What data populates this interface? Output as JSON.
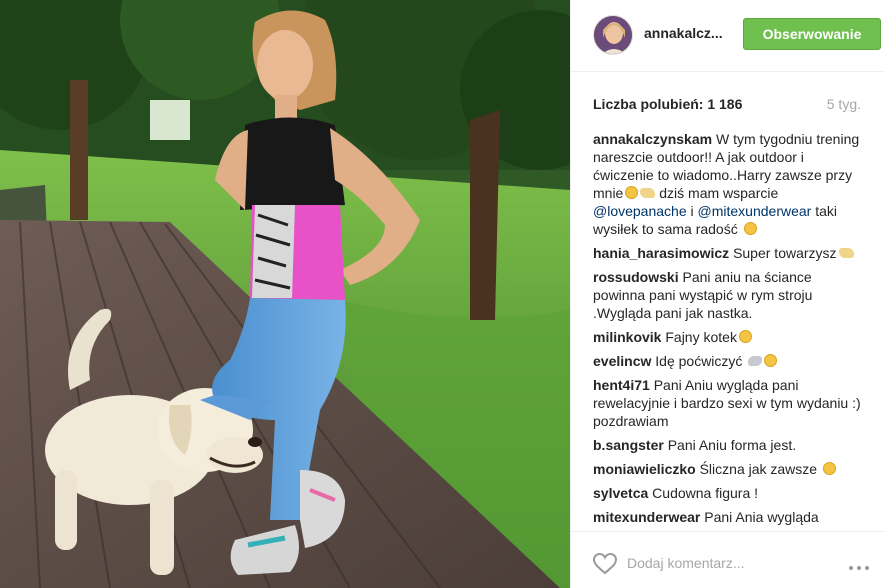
{
  "post": {
    "username": "annakalcz...",
    "follow_label": "Obserwowanie",
    "likes_text": "Liczba polubień: 1 186",
    "age_text": "5 tyg."
  },
  "comments": [
    {
      "user": "annakalczynskam",
      "parts": [
        {
          "t": "W tym tygodniu trening nareszcie outdoor!! A jak outdoor i ćwiczenie to wiadomo..Harry zawsze przy mnie"
        },
        {
          "emoji": "face"
        },
        {
          "emoji": "dog"
        },
        {
          "t": " dziś mam wsparcie "
        },
        {
          "mention": "@lovepanache"
        },
        {
          "t": " i "
        },
        {
          "mention": "@mitexunderwear"
        },
        {
          "t": " taki wysiłek to sama radość "
        },
        {
          "emoji": "face"
        }
      ]
    },
    {
      "user": "hania_harasimowicz",
      "parts": [
        {
          "t": "Super towarzysz"
        },
        {
          "emoji": "dog"
        }
      ]
    },
    {
      "user": "rossudowski",
      "parts": [
        {
          "t": "Pani aniu na ściance powinna pani wystąpić w rym stroju .Wygląda pani jak nastka."
        }
      ]
    },
    {
      "user": "milinkovik",
      "parts": [
        {
          "t": "Fajny kotek"
        },
        {
          "emoji": "face"
        }
      ]
    },
    {
      "user": "evelincw",
      "parts": [
        {
          "t": "Idę poćwiczyć "
        },
        {
          "emoji": "arm"
        },
        {
          "emoji": "face"
        }
      ]
    },
    {
      "user": "hent4i71",
      "parts": [
        {
          "t": "Pani Aniu wygląda pani rewelacyjnie i bardzo sexi w tym wydaniu :) pozdrawiam"
        }
      ]
    },
    {
      "user": "b.sangster",
      "parts": [
        {
          "t": "Pani Aniu forma jest."
        }
      ]
    },
    {
      "user": "moniawieliczko",
      "parts": [
        {
          "t": "Śliczna jak zawsze "
        },
        {
          "emoji": "face"
        }
      ]
    },
    {
      "user": "sylvetca",
      "parts": [
        {
          "t": "Cudowna figura !"
        }
      ]
    },
    {
      "user": "mitexunderwear",
      "parts": [
        {
          "t": "Pani Ania wygląda"
        }
      ]
    }
  ],
  "comment_bar": {
    "placeholder": "Dodaj komentarz...",
    "like_icon": "heart-outline-icon",
    "more_icon": "more-horizontal-icon"
  },
  "colors": {
    "follow_button": "#70c050",
    "mention": "#003569",
    "muted": "#a5a7aa"
  }
}
